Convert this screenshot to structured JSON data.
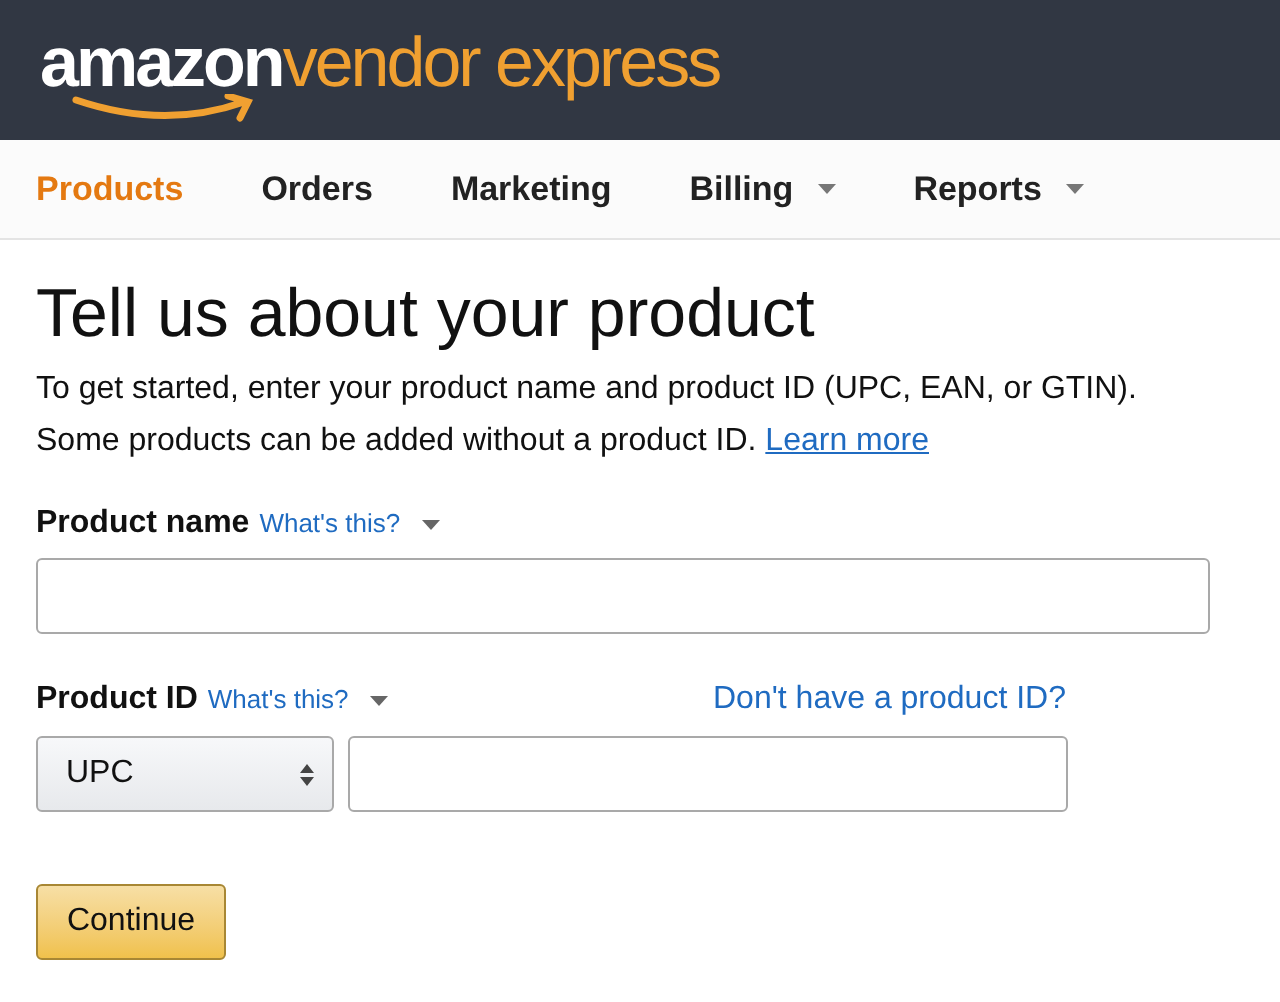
{
  "header": {
    "logo_brand": "amazon",
    "logo_product": "vendor express"
  },
  "nav": [
    {
      "label": "Products",
      "selected": true,
      "dropdown": false
    },
    {
      "label": "Orders",
      "selected": false,
      "dropdown": false
    },
    {
      "label": "Marketing",
      "selected": false,
      "dropdown": false
    },
    {
      "label": "Billing",
      "selected": false,
      "dropdown": true
    },
    {
      "label": "Reports",
      "selected": false,
      "dropdown": true
    }
  ],
  "title": "Tell us about your product",
  "intro": {
    "text": "To get started, enter your product name and product ID (UPC, EAN, or GTIN).\nSome products can be added without a product ID.",
    "link": "Learn more"
  },
  "product_name": {
    "label": "Product name",
    "help": "What's this?"
  },
  "product_id": {
    "label": "Product ID",
    "help": "What's this?",
    "alt_link": "Don't have a product ID?",
    "type_value": "UPC"
  },
  "continue_button": "Continue"
}
